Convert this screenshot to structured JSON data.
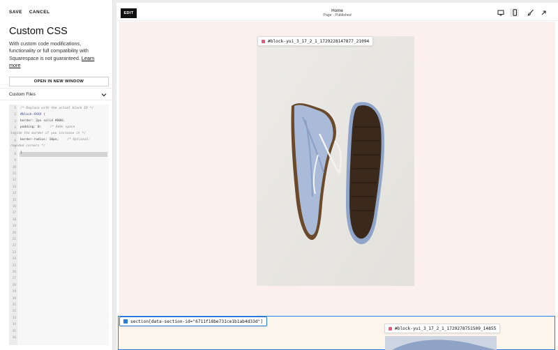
{
  "left_panel": {
    "save_label": "SAVE",
    "cancel_label": "CANCEL",
    "title": "Custom CSS",
    "description": "With custom code modifications, functionality or full compatibility with Squarespace is not guaranteed.",
    "learn_more": "Learn more",
    "open_window_label": "OPEN IN NEW WINDOW",
    "custom_files_label": "Custom Files",
    "code_lines": [
      "/* Replace with the actual block ID */",
      "#block-XXXX {",
      "  border: 2px solid #000;",
      "  padding: 0;",
      "inside the border if you increase it */",
      "  border-radius: 10px;",
      "rounded corners */",
      "}"
    ],
    "code_comment_padding": "/* Adds space",
    "code_comment_radius": "/* Optional:",
    "line_numbers": [
      "1",
      "2",
      "3",
      "4",
      "5",
      "6",
      "7",
      "8",
      "9",
      "10",
      "11",
      "12",
      "13",
      "14",
      "15",
      "16",
      "17",
      "18",
      "19",
      "20",
      "21",
      "22",
      "23",
      "24",
      "25",
      "26",
      "27",
      "28",
      "29",
      "30",
      "31",
      "32",
      "33",
      "34",
      "35",
      "36"
    ]
  },
  "toolbar": {
    "edit_label": "EDIT",
    "page_title": "Home",
    "page_status": "Page · Published",
    "icons": [
      "desktop-icon",
      "mobile-icon",
      "brush-icon",
      "expand-icon"
    ]
  },
  "canvas": {
    "block_tag_1": "#block-yui_3_17_2_1_1729228147877_21094",
    "section_tag": "section[data-section-id=\"6711f18be731ce1b1ab4d33d\"]",
    "block_tag_2": "#block-yui_3_17_2_1_1729278751509_14855"
  },
  "colors": {
    "canvas_bg": "#fcf0ee",
    "section_outline": "#2b7bd6",
    "block_dot": "#e35a7a"
  }
}
